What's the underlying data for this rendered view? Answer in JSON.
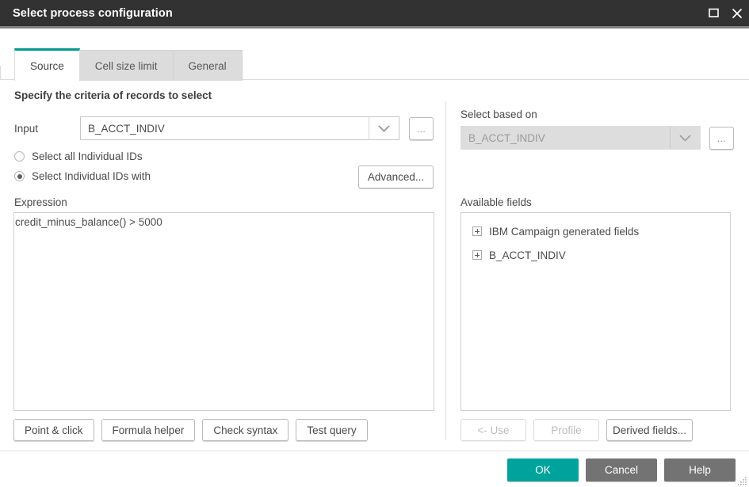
{
  "window": {
    "title": "Select process configuration",
    "controls": [
      {
        "name": "maximize-button",
        "icon": "maximize-icon"
      },
      {
        "name": "close-button",
        "icon": "close-icon"
      }
    ]
  },
  "tabs": [
    {
      "label": "Source",
      "active": true
    },
    {
      "label": "Cell size limit",
      "active": false
    },
    {
      "label": "General",
      "active": false
    }
  ],
  "source_tab": {
    "section_title": "Specify the criteria of records to select",
    "input": {
      "label": "Input",
      "value": "B_ACCT_INDIV",
      "browse_label": "...",
      "dropdown_icon": "chevron-down-icon"
    },
    "radios": [
      {
        "label": "Select all Individual IDs",
        "checked": false
      },
      {
        "label": "Select Individual IDs with",
        "checked": true
      }
    ],
    "advanced_label": "Advanced...",
    "expression": {
      "label": "Expression",
      "value": "credit_minus_balance() > 5000"
    },
    "expression_buttons": [
      {
        "label": "Point & click",
        "enabled": true
      },
      {
        "label": "Formula helper",
        "enabled": true
      },
      {
        "label": "Check syntax",
        "enabled": true
      },
      {
        "label": "Test query",
        "enabled": true
      }
    ],
    "select_based_on": {
      "label": "Select based on",
      "value": "B_ACCT_INDIV",
      "browse_label": "...",
      "disabled": true,
      "dropdown_icon": "chevron-down-icon"
    },
    "available_fields": {
      "label": "Available fields",
      "items": [
        {
          "label": "IBM Campaign generated fields",
          "expanded": false
        },
        {
          "label": "B_ACCT_INDIV",
          "expanded": false
        }
      ]
    },
    "field_buttons": [
      {
        "label": "<- Use",
        "enabled": false
      },
      {
        "label": "Profile",
        "enabled": false
      },
      {
        "label": "Derived fields...",
        "enabled": true
      }
    ]
  },
  "footer": {
    "buttons": [
      {
        "label": "OK",
        "style": "primary"
      },
      {
        "label": "Cancel",
        "style": "secondary"
      },
      {
        "label": "Help",
        "style": "secondary"
      }
    ]
  },
  "colors": {
    "titlebar": "#323232",
    "accent_teal": "#00998f",
    "primary_button": "#00a39c",
    "secondary_button": "#737373"
  }
}
